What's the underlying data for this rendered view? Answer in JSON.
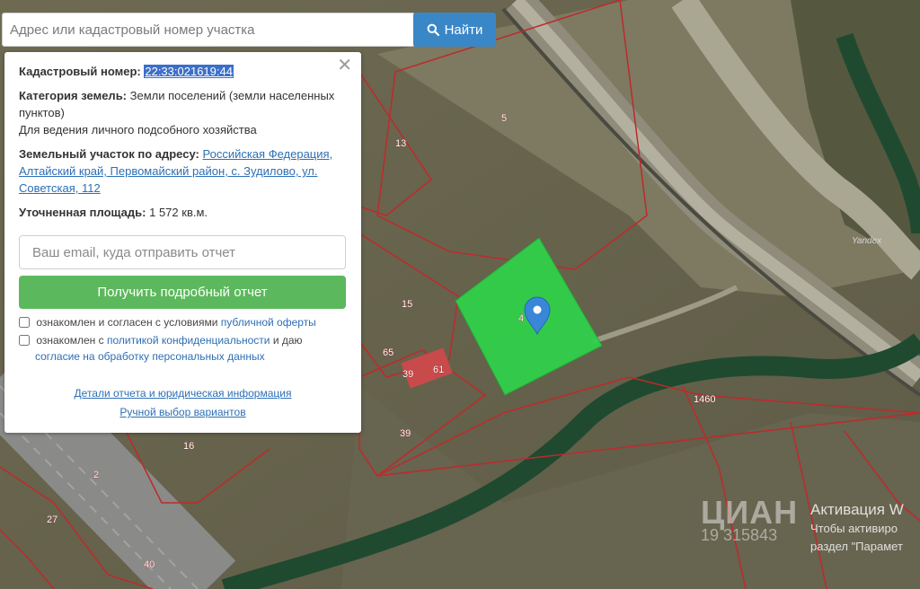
{
  "search": {
    "placeholder": "Адрес или кадастровый номер участка",
    "button_label": "Найти"
  },
  "panel": {
    "cad_label": "Кадастровый номер:",
    "cad_number": "22:33:021619:44",
    "category_label": "Категория земель:",
    "category_value": "Земли поселений (земли населенных пунктов)",
    "usage": "Для ведения личного подсобного хозяйства",
    "address_label": "Земельный участок по адресу:",
    "address_value": "Российская Федерация, Алтайский край, Первомайский район, с. Зудилово, ул. Советская, 112",
    "area_label": "Уточненная площадь:",
    "area_value": "1 572 кв.м.",
    "email_placeholder": "Ваш email, куда отправить отчет",
    "report_button": "Получить подробный отчет",
    "consent1_text": "ознакомлен и согласен с условиями",
    "consent1_link": "публичной оферты",
    "consent2_text_a": "ознакомлен с",
    "consent2_link_a": "политикой конфиденциальности",
    "consent2_text_b": "и даю",
    "consent2_link_b": "согласие на обработку персональных данных",
    "details_link": "Детали отчета и юридическая информация",
    "manual_link": "Ручной выбор вариантов",
    "close_glyph": "✕"
  },
  "map": {
    "parcel_labels": [
      "5",
      "13",
      "15",
      "65",
      "39",
      "61",
      "39",
      "16",
      "2",
      "27",
      "40",
      "1460",
      "4"
    ],
    "attribution": "Yandex",
    "watermark": "ЦИАН",
    "watermark_sub": "19 315843"
  },
  "system": {
    "activation_title": "Активация W",
    "activation_line1": "Чтобы активиро",
    "activation_line2": "раздел \"Парамет"
  },
  "colors": {
    "accent": "#3a87c8",
    "primary_button": "#5cb85c",
    "parcel_outline": "#c0292b",
    "selected_parcel": "#2fd24a"
  },
  "icons": {
    "search": "search-icon",
    "close": "close-icon",
    "map_pin": "map-pin-icon"
  }
}
